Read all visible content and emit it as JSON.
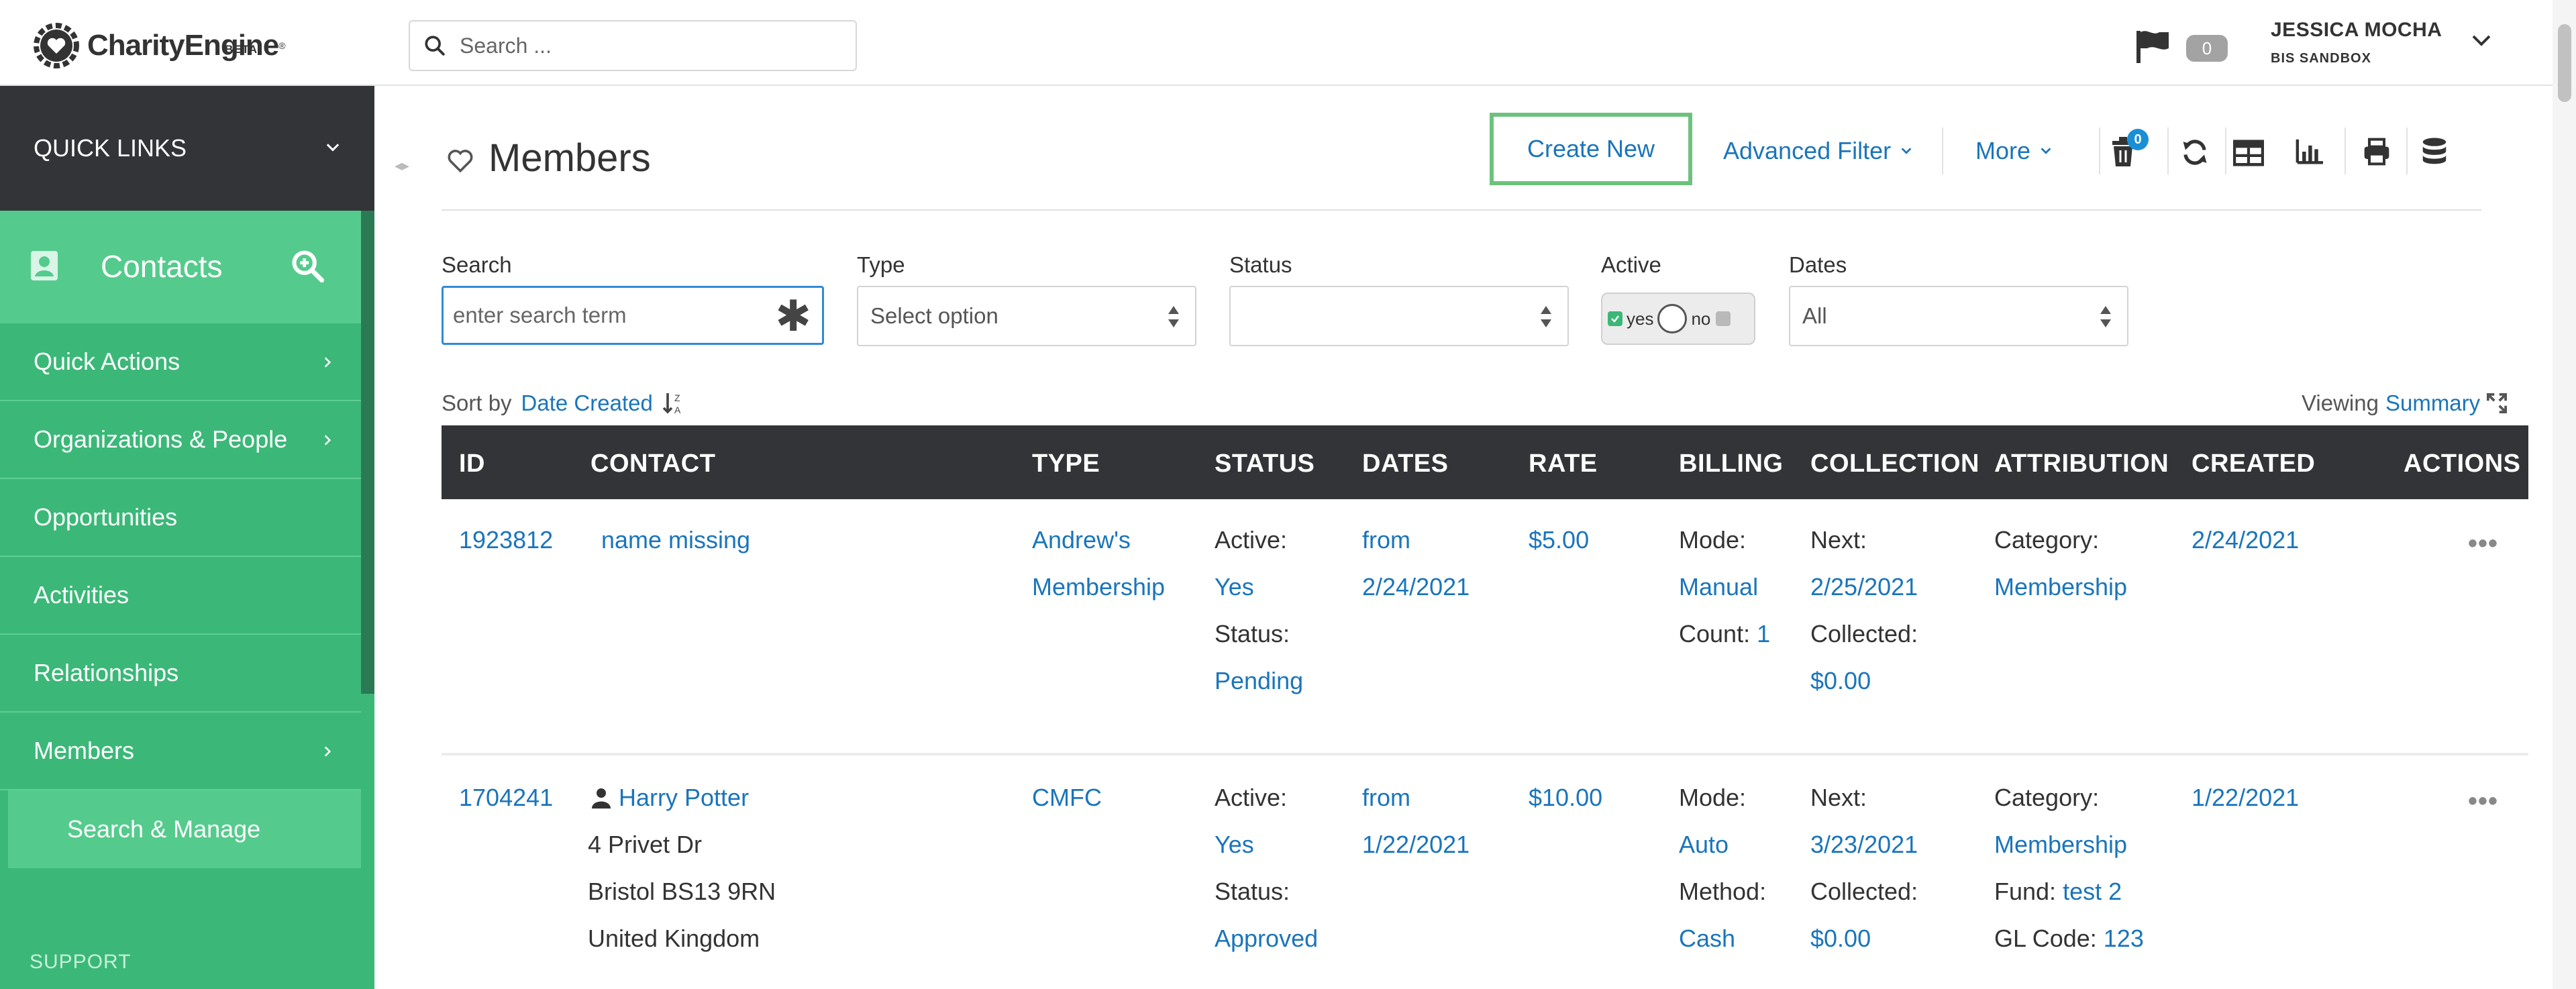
{
  "app": {
    "logo_text": "CharityEngine",
    "logo_beta": "BETA",
    "search_placeholder": "Search ...",
    "notifications_count": "0",
    "user_name": "JESSICA MOCHA",
    "user_org": "BIS SANDBOX"
  },
  "sidebar": {
    "quick_links": "QUICK LINKS",
    "section": "Contacts",
    "items": [
      {
        "label": "Quick Actions",
        "chevron": true
      },
      {
        "label": "Organizations & People",
        "chevron": true
      },
      {
        "label": "Opportunities",
        "chevron": false
      },
      {
        "label": "Activities",
        "chevron": false
      },
      {
        "label": "Relationships",
        "chevron": false
      },
      {
        "label": "Members",
        "chevron": true
      }
    ],
    "sub_item": "Search & Manage",
    "support": "SUPPORT"
  },
  "page": {
    "title": "Members",
    "toolbar": {
      "create_new": "Create New",
      "advanced_filter": "Advanced Filter",
      "more": "More",
      "trash_count": "0"
    },
    "filters": {
      "search_label": "Search",
      "search_placeholder": "enter search term",
      "type_label": "Type",
      "type_value": "Select option",
      "status_label": "Status",
      "status_value": "",
      "active_label": "Active",
      "active_yes": "yes",
      "active_no": "no",
      "dates_label": "Dates",
      "dates_value": "All"
    },
    "sort": {
      "prefix": "Sort by",
      "field": "Date Created"
    },
    "viewing": {
      "prefix": "Viewing",
      "mode": "Summary"
    }
  },
  "table": {
    "columns": [
      "ID",
      "CONTACT",
      "TYPE",
      "STATUS",
      "DATES",
      "RATE",
      "BILLING",
      "COLLECTION",
      "ATTRIBUTION",
      "CREATED",
      "ACTIONS"
    ],
    "rows": [
      {
        "id": "1923812",
        "contact_name": "name missing",
        "address": [],
        "type": [
          "Andrew's",
          "Membership"
        ],
        "status": {
          "active_label": "Active:",
          "active_value": "Yes",
          "status_label": "Status:",
          "status_value": "Pending"
        },
        "dates": [
          "from",
          "2/24/2021"
        ],
        "rate": "$5.00",
        "billing": {
          "l1": "Mode:",
          "v1": "Manual",
          "l2": "Count:",
          "v2": "1"
        },
        "collection": {
          "l1": "Next:",
          "v1": "2/25/2021",
          "l2": "Collected:",
          "v2": "$0.00"
        },
        "attribution": {
          "l1": "Category:",
          "v1": "Membership",
          "l2": "",
          "v2": "",
          "l3": "",
          "v3": ""
        },
        "created": "2/24/2021",
        "actions": "•••"
      },
      {
        "id": "1704241",
        "contact_name": "Harry Potter",
        "address": [
          "4 Privet Dr",
          "Bristol BS13 9RN",
          "United Kingdom"
        ],
        "type": [
          "CMFC"
        ],
        "status": {
          "active_label": "Active:",
          "active_value": "Yes",
          "status_label": "Status:",
          "status_value": "Approved"
        },
        "dates": [
          "from",
          "1/22/2021"
        ],
        "rate": "$10.00",
        "billing": {
          "l1": "Mode:",
          "v1": "Auto",
          "l2": "Method:",
          "v2": "Cash"
        },
        "collection": {
          "l1": "Next:",
          "v1": "3/23/2021",
          "l2": "Collected:",
          "v2": "$0.00"
        },
        "attribution": {
          "l1": "Category:",
          "v1": "Membership",
          "l2": "Fund:",
          "v2": "test 2",
          "l3": "GL Code:",
          "v3": "123"
        },
        "created": "1/22/2021",
        "actions": "•••"
      }
    ]
  },
  "colors": {
    "sidebar_green": "#3bb878",
    "sidebar_active": "#54cb8c",
    "dark": "#333437",
    "link": "#1a75bb",
    "create_border": "#6cc27c"
  }
}
